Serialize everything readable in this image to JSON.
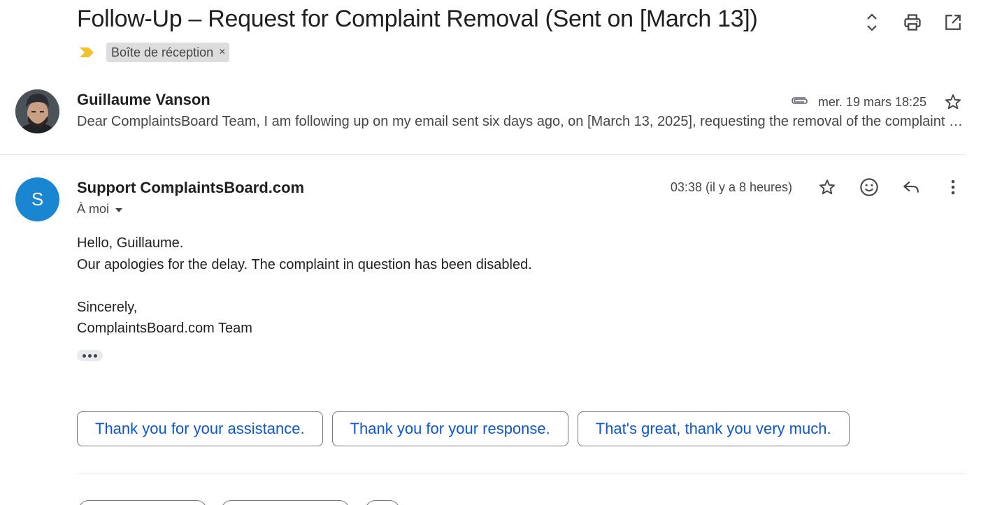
{
  "subject": "Follow-Up – Request for Complaint Removal (Sent on [March 13])",
  "header_actions": {
    "expand_icon": "unfold-icon",
    "print_icon": "print-icon",
    "open_new_window_icon": "open-in-new-icon"
  },
  "label_chip": {
    "label": "Boîte de réception",
    "remove": "×"
  },
  "colors": {
    "importance": "#f2c12e",
    "link_blue": "#0b57d0",
    "avatar_blue": "#1a86d1"
  },
  "message1": {
    "sender": "Guillaume Vanson",
    "snippet": "Dear ComplaintsBoard Team, I am following up on my email sent six days ago, on [March 13, 2025], requesting the removal of the complaint regarding my name.",
    "date": "mer. 19 mars 18:25",
    "has_attachment": true
  },
  "message2": {
    "avatar_letter": "S",
    "sender": "Support ComplaintsBoard.com",
    "to": "À moi",
    "date": "03:38 (il y a 8 heures)",
    "body": {
      "line1": "Hello, Guillaume.",
      "line2": "Our apologies for the delay. The complaint in question has been disabled.",
      "line3": "Sincerely,",
      "line4": "ComplaintsBoard.com Team"
    }
  },
  "smart_replies": [
    "Thank you for your assistance.",
    "Thank you for your response.",
    "That's great, thank you very much."
  ]
}
